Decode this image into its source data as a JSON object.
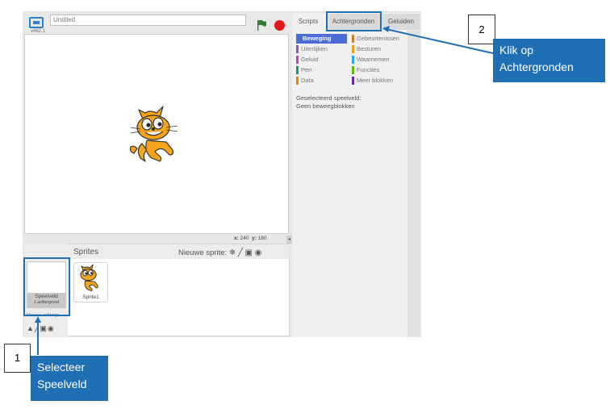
{
  "stage_header": {
    "version": "v462.1",
    "title_value": "Untitled"
  },
  "stage": {
    "x_label": "x:",
    "x_value": "240",
    "y_label": "y:",
    "y_value": "180",
    "collapse_glyph": "◂"
  },
  "sprite_pane": {
    "sprites_label": "Sprites",
    "new_sprite_label": "Nieuwe sprite:",
    "stage_thumb": {
      "name": "Speelveld",
      "sub": "1 achtergrond"
    },
    "sprite1": {
      "name": "Sprite1"
    },
    "new_backdrop_label": "Nieuwe achtergr.",
    "icons": [
      "paint-icon",
      "brush-icon",
      "upload-icon",
      "camera-icon"
    ]
  },
  "tabs": [
    {
      "label": "Scripts"
    },
    {
      "label": "Achtergronden"
    },
    {
      "label": "Geluiden"
    }
  ],
  "categories": {
    "left": [
      {
        "label": "Beweging",
        "color": "#4a6cd4"
      },
      {
        "label": "Uiterlijken",
        "color": "#8a55d7"
      },
      {
        "label": "Geluid",
        "color": "#bb42c3"
      },
      {
        "label": "Pen",
        "color": "#0e9a6c"
      },
      {
        "label": "Data",
        "color": "#ee7d16"
      }
    ],
    "right": [
      {
        "label": "Gebeurtenissen",
        "color": "#c88330"
      },
      {
        "label": "Besturen",
        "color": "#e1a91a"
      },
      {
        "label": "Waarnemen",
        "color": "#2ca5e2"
      },
      {
        "label": "Functies",
        "color": "#5cb712"
      },
      {
        "label": "Meer blokken",
        "color": "#632d99"
      }
    ]
  },
  "palette_message": {
    "line1": "Geselecteerd speelveld:",
    "line2": "Geen beweegblokken"
  },
  "callouts": {
    "step1_number": "1",
    "step1_text": "Selecteer Speelveld",
    "step2_number": "2",
    "step2_text": "Klik op Achtergronden"
  },
  "colors": {
    "accent": "#1f6fb5",
    "stop": "#e3161d",
    "flag": "#2e7d32",
    "cat_orange": "#f7a51c"
  }
}
